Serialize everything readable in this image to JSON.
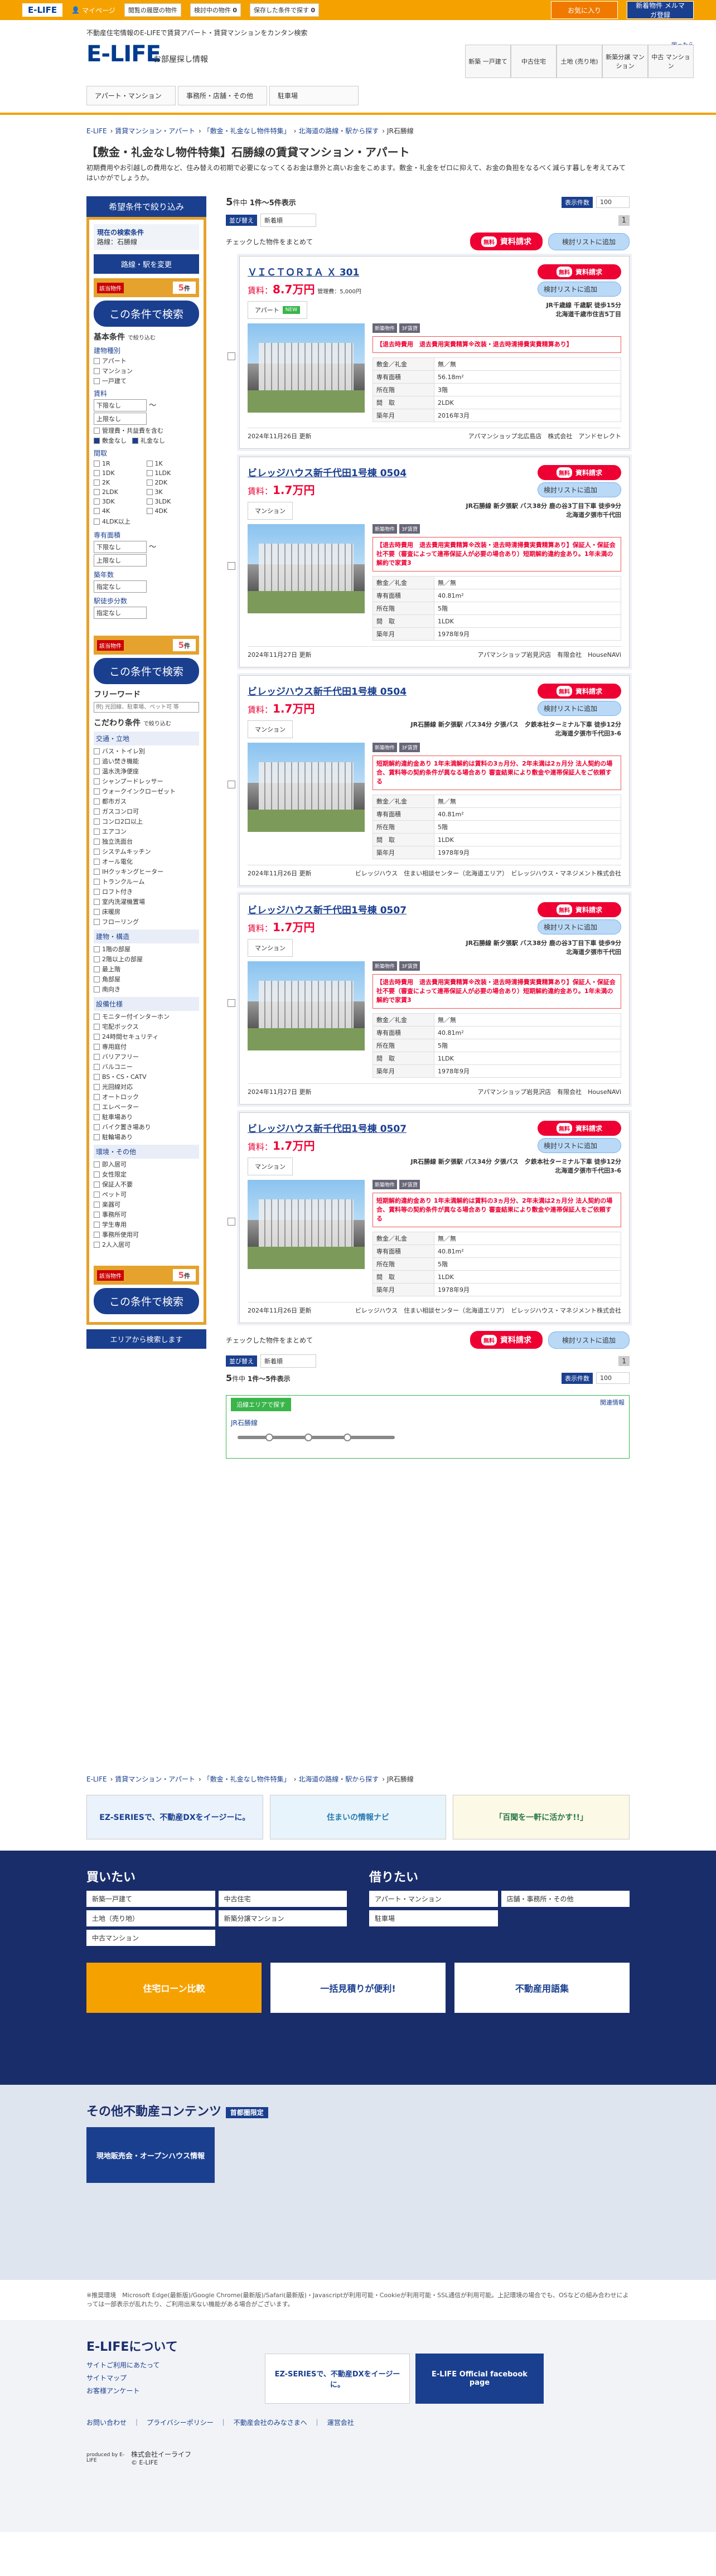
{
  "topbar": {
    "logo": "E-LIFE",
    "item1": "マイページ",
    "item2": "閲覧の履歴の物件",
    "item3": "検討中の物件",
    "item3_count": "0",
    "item4": "保存した条件で探す",
    "item4_count": "0",
    "cta1": "お気に入り"
  },
  "header": {
    "tagline": "不動産住宅情報のE-LIFEで賃貸アパート・賃貸マンションをカンタン検索",
    "logo": "E-LIFE",
    "logo_sub": "お部屋探し情報",
    "help": "困ったら",
    "nav": [
      "新築\n一戸建て",
      "中古住宅",
      "土地\n(売り地)",
      "新築分譲\nマンション",
      "中古\nマンション"
    ],
    "cta": "新着物件\nメルマガ登録",
    "subnav": [
      "アパート・マンション",
      "事務所・店舗・その他",
      "駐車場"
    ]
  },
  "breadcrumb": [
    "E-LIFE",
    "賃貸マンション・アパート",
    "「敷金・礼金なし物件特集」",
    "北海道の路線・駅から探す",
    "JR石勝線"
  ],
  "page": {
    "title": "【敷金・礼金なし物件特集】石勝線の賃貸マンション・アパート",
    "lead": "初期費用やお引越しの費用など、住み替えの初期で必要になってくるお金は意外と高いお金をこめます。敷金・礼金をゼロに抑えて、お金の負担をなるべく減らす暮しを考えてみてはいかがでしょうか。"
  },
  "sidebar": {
    "title": "希望条件で絞り込み",
    "current": "現在の検索条件",
    "route": "路線：石勝線",
    "route_btn": "路線・駅を変更",
    "result_label": "該当物件",
    "count": "5",
    "count_unit": "件",
    "search_btn": "この条件で検索",
    "basic": "基本条件",
    "basic_note": "で絞り込む",
    "type_title": "建物種別",
    "types": [
      "アパート",
      "マンション",
      "一戸建て"
    ],
    "rent_title": "賃料",
    "rent_min": "下限なし",
    "rent_max": "上限なし",
    "rent_opts": [
      "管理費・共益費を含む",
      "敷金なし",
      "礼金なし"
    ],
    "layout_title": "間取",
    "layouts": [
      "1R",
      "1K",
      "1DK",
      "1LDK",
      "2K",
      "2DK",
      "2LDK",
      "3K",
      "3DK",
      "3LDK",
      "4K",
      "4DK",
      "4LDK以上"
    ],
    "area_title": "専有面積",
    "area_min": "下限なし",
    "area_max": "上限なし",
    "age_title": "築年数",
    "age_sel": "指定なし",
    "walk_title": "駅徒歩分数",
    "walk_sel": "指定なし",
    "freeword": "フリーワード",
    "freeword_ph": "例) 光回線、駐車場、ペット可 等",
    "pref": "こだわり条件",
    "pref_note": "で絞り込む",
    "cat1": "交通・立地",
    "cat1_items": [
      "バス・トイレ別",
      "追い焚き機能",
      "温水洗浄便座",
      "シャンプードレッサー",
      "ウォークインクローゼット",
      "都市ガス",
      "ガスコンロ可",
      "コンロ2口以上",
      "エアコン",
      "独立洗面台",
      "システムキッチン",
      "オール電化",
      "IHクッキングヒーター",
      "トランクルーム",
      "ロフト付き",
      "室内洗濯機置場",
      "床暖房",
      "フローリング"
    ],
    "cat2": "建物・構造",
    "cat2_items": [
      "1階の部屋",
      "2階以上の部屋",
      "最上階",
      "角部屋",
      "南向き"
    ],
    "cat3": "設備仕様",
    "cat3_items": [
      "モニター付インターホン",
      "宅配ボックス",
      "24時間セキュリティ",
      "専用庭付",
      "バリアフリー",
      "バルコニー",
      "BS・CS・CATV",
      "光回線対応",
      "オートロック",
      "エレベーター",
      "駐車場あり",
      "バイク置き場あり",
      "駐輪場あり"
    ],
    "cat4": "環境・その他",
    "cat4_items": [
      "即入居可",
      "女性限定",
      "保証人不要",
      "ペット可",
      "楽器可",
      "事務所可",
      "学生専用",
      "事務所使用可",
      "2人入居可"
    ],
    "map_btn": "エリアから検索します"
  },
  "results": {
    "count_prefix": "5",
    "count_mid": "件中",
    "range": "1件～5件表示",
    "per_page_label": "表示件数",
    "per_page": "100",
    "sort_label": "並び替え",
    "sort_value": "新着順",
    "page": "1",
    "bulk_label": "チェックした物件をまとめて",
    "req_free": "無料",
    "req_label": "資料請求",
    "fav_label": "検討リストに追加"
  },
  "cards": [
    {
      "name": "ＶＩＣＴＯＲＩＡ Ｘ 301",
      "rent": "8.7万円",
      "fee": "管理費：5,000円",
      "type": "アパート",
      "new": "NEW",
      "access": "JR千歳線 千歳駅 徒歩15分",
      "address": "北海道千歳市住吉5丁目",
      "tags": [
        "新築物件",
        "3F賃貸"
      ],
      "desc": "【退去時費用　退去費用実費精算※改装・退去時清掃費実費精算あり】",
      "deposit": "無／無",
      "area": "56.18m²",
      "floor": "3階",
      "layout": "2LDK",
      "built": "2016年3月",
      "date": "2024年11月26日 更新",
      "agent": "アパマンショップ北広島店　株式会社　アンドセレクト"
    },
    {
      "name": "ビレッジハウス新千代田1号棟 0504",
      "rent": "1.7万円",
      "fee": "",
      "type": "マンション",
      "new": "",
      "access": "JR石勝線 新夕張駅 バス38分 鹿の谷3丁目下車 徒歩9分",
      "address": "北海道夕張市千代田",
      "tags": [
        "新築物件",
        "3F賃貸"
      ],
      "desc": "【退去時費用　退去費用実費精算※改装・退去時清掃費実費精算あり】保証人・保証会社不要（審査によって連帯保証人が必要の場合あり）短期解約違約金あり。1年未満の解約で家賃3",
      "deposit": "無／無",
      "area": "40.81m²",
      "floor": "5階",
      "layout": "1LDK",
      "built": "1978年9月",
      "date": "2024年11月27日 更新",
      "agent": "アパマンショップ岩見沢店　有限会社　HouseNAVi"
    },
    {
      "name": "ビレッジハウス新千代田1号棟 0504",
      "rent": "1.7万円",
      "fee": "",
      "type": "マンション",
      "new": "",
      "access": "JR石勝線 新夕張駅 バス34分 夕張バス　夕鉄本社ターミナル下車 徒歩12分",
      "address": "北海道夕張市千代田3-6",
      "tags": [
        "新築物件",
        "3F賃貸"
      ],
      "desc": "短期解約違約金あり 1年未満解約は賃料の3ヵ月分、2年未満は2ヵ月分 法人契約の場合、賃料等の契約条件が異なる場合あり 審査結果により敷金や連帯保証人をご依頼する",
      "deposit": "無／無",
      "area": "40.81m²",
      "floor": "5階",
      "layout": "1LDK",
      "built": "1978年9月",
      "date": "2024年11月26日 更新",
      "agent": "ビレッジハウス　住まい相談センター（北海道エリア）　ビレッジハウス・マネジメント株式会社"
    },
    {
      "name": "ビレッジハウス新千代田1号棟 0507",
      "rent": "1.7万円",
      "fee": "",
      "type": "マンション",
      "new": "",
      "access": "JR石勝線 新夕張駅 バス38分 鹿の谷3丁目下車 徒歩9分",
      "address": "北海道夕張市千代田",
      "tags": [
        "新築物件",
        "3F賃貸"
      ],
      "desc": "【退去時費用　退去費用実費精算※改装・退去時清掃費実費精算あり】保証人・保証会社不要（審査によって連帯保証人が必要の場合あり）短期解約違約金あり。1年未満の解約で家賃3",
      "deposit": "無／無",
      "area": "40.81m²",
      "floor": "5階",
      "layout": "1LDK",
      "built": "1978年9月",
      "date": "2024年11月27日 更新",
      "agent": "アパマンショップ岩見沢店　有限会社　HouseNAVi"
    },
    {
      "name": "ビレッジハウス新千代田1号棟 0507",
      "rent": "1.7万円",
      "fee": "",
      "type": "マンション",
      "new": "",
      "access": "JR石勝線 新夕張駅 バス34分 夕張バス　夕鉄本社ターミナル下車 徒歩12分",
      "address": "北海道夕張市千代田3-6",
      "tags": [
        "新築物件",
        "3F賃貸"
      ],
      "desc": "短期解約違約金あり 1年未満解約は賃料の3ヵ月分、2年未満は2ヵ月分 法人契約の場合、賃料等の契約条件が異なる場合あり 審査結果により敷金や連帯保証人をご依頼する",
      "deposit": "無／無",
      "area": "40.81m²",
      "floor": "5階",
      "layout": "1LDK",
      "built": "1978年9月",
      "date": "2024年11月26日 更新",
      "agent": "ビレッジハウス　住まい相談センター（北海道エリア）　ビレッジハウス・マネジメント株式会社"
    }
  ],
  "labels": {
    "deposit": "敷金／礼金",
    "area": "専有面積",
    "floor": "所在階",
    "layout": "間　取",
    "built": "築年月"
  },
  "line": {
    "title": "沿線エリアで探す",
    "link": "関連情報",
    "name": "JR石勝線"
  },
  "banners": [
    "EZ-SERIESで、不動産DXをイージーに。",
    "住まいの情報ナビ",
    "「百聞を一軒に活かす!!」"
  ],
  "buy": {
    "title": "買いたい",
    "links": [
      "新築一戸建て",
      "中古住宅",
      "土地（売り地）",
      "新築分譲マンション",
      "中古マンション"
    ]
  },
  "rent": {
    "title": "借りたい",
    "links": [
      "アパート・マンション",
      "店舗・事務所・その他",
      "駐車場"
    ]
  },
  "promo": [
    "住宅ローン比較",
    "一括見積りが便利!",
    "不動産用語集"
  ],
  "others": {
    "title": "その他不動産コンテンツ",
    "badge": "首都圏限定",
    "item": "現地販売会・オープンハウス情報"
  },
  "notes": "※推奨環境　Microsoft Edge(最新版)/Google Chrome(最新版)/Safari(最新版)・Javascriptが利用可能・Cookieが利用可能・SSL通信が利用可能。上記環境の場合でも、OSなどの組み合わせによっては一部表示が乱れたり、ご利用出来ない機能がある場合がございます。",
  "about": {
    "title": "E-LIFEについて",
    "links": [
      "サイトご利用にあたって",
      "サイトマップ",
      "お客様アンケート"
    ],
    "bn1": "EZ-SERIESで、不動産DXをイージーに。",
    "bn2": "E-LIFE Official facebook page"
  },
  "bottom": {
    "links": "お問い合わせ　｜　プライバシーポリシー　｜　不動産会社のみなさまへ　｜　運営会社",
    "company": "株式会社イーライフ",
    "copy": "© E-LIFE",
    "produced": "produced by E-LIFE"
  }
}
